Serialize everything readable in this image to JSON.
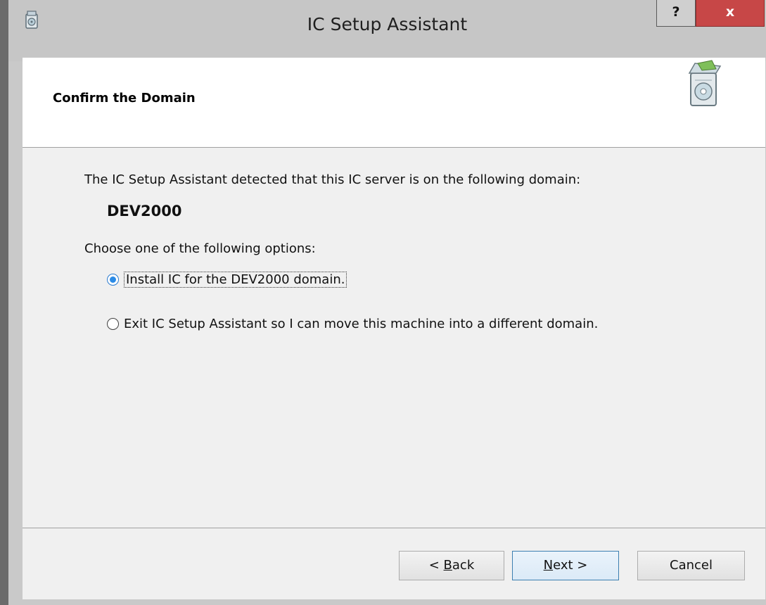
{
  "window": {
    "title": "IC Setup Assistant",
    "help_label": "?",
    "close_label": "x"
  },
  "header": {
    "title": "Confirm the Domain",
    "icon": "installer-box-icon"
  },
  "content": {
    "intro": "The IC Setup Assistant detected that this IC server is on the following domain:",
    "domain": "DEV2000",
    "choose": "Choose one of the following options:",
    "options": [
      {
        "label": "Install IC for the DEV2000 domain.",
        "selected": true
      },
      {
        "label": "Exit IC Setup Assistant so I can move this machine into a different domain.",
        "selected": false
      }
    ]
  },
  "footer": {
    "back_prefix": "< ",
    "back_key": "B",
    "back_rest": "ack",
    "next_key": "N",
    "next_rest": "ext >",
    "cancel_label": "Cancel"
  },
  "colors": {
    "accent": "#2b8be6",
    "close_button": "#c74747"
  }
}
